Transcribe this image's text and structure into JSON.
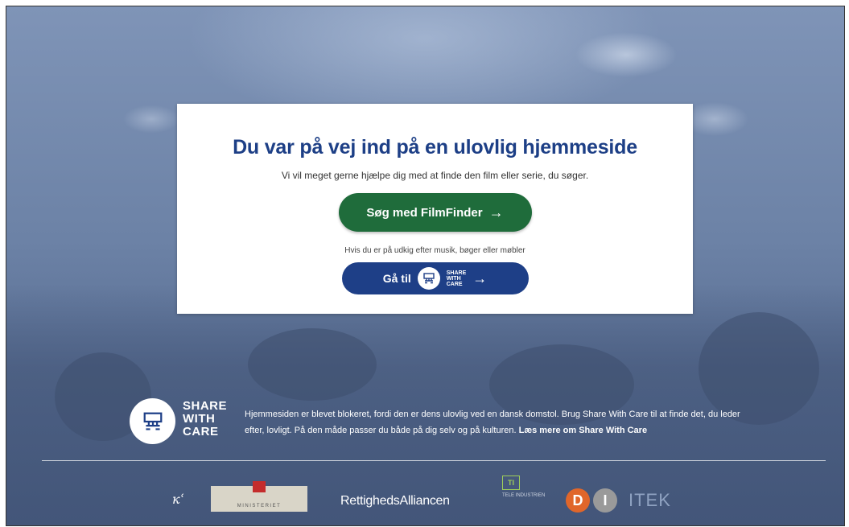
{
  "card": {
    "heading": "Du var på vej ind på en ulovlig hjemmeside",
    "subtext": "Vi vil meget gerne hjælpe dig med at finde den film eller serie, du søger.",
    "filmfinder_label": "Søg med FilmFinder",
    "arrow": "→",
    "hint": "Hvis du er på udkig efter musik, bøger eller møbler",
    "goto_label": "Gå til",
    "swc_lines": [
      "SHARE",
      "WITH",
      "CARE"
    ]
  },
  "footer": {
    "logo_lines": [
      "SHARE",
      "WITH",
      "CARE"
    ],
    "text_main": "Hjemmesiden er blevet blokeret, fordi den er dens ulovlig ved en dansk domstol. Brug Share With Care til at finde det, du leder efter, lovligt. På den måde passer du både på dig selv og på kulturen.",
    "read_more": "Læs mere om Share With Care"
  },
  "partners": {
    "kulturministeriet": "MINISTERIET",
    "rettigheds": "RettighedsAlliancen",
    "tele_box": "TI",
    "tele_text": "TELE INDUSTRIEN",
    "di_d": "D",
    "di_i": "I",
    "itek": "ITEK"
  },
  "colors": {
    "heading": "#1d3f86",
    "filmfinder": "#1f6c3b",
    "swc_button": "#1e3f87",
    "di_d": "#e0662a",
    "di_i": "#9a9a9a"
  }
}
